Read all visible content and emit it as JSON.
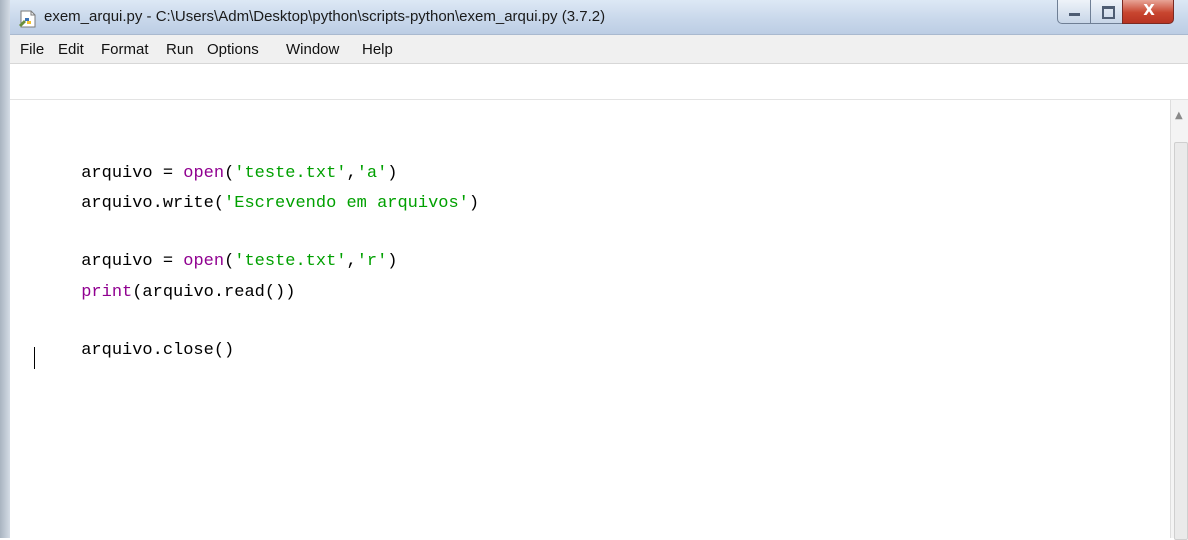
{
  "window": {
    "title": "exem_arqui.py - C:\\Users\\Adm\\Desktop\\python\\scripts-python\\exem_arqui.py (3.7.2)",
    "controls": {
      "minimize_icon": "minimize-icon",
      "maximize_icon": "maximize-icon",
      "close_label": "X"
    }
  },
  "menu": {
    "items": [
      {
        "label": "File"
      },
      {
        "label": "Edit"
      },
      {
        "label": "Format"
      },
      {
        "label": "Run"
      },
      {
        "label": "Options"
      },
      {
        "label": "Window"
      },
      {
        "label": "Help"
      }
    ]
  },
  "editor": {
    "lines": [
      {
        "parts": [
          {
            "text": "arquivo = ",
            "kind": "plain"
          },
          {
            "text": "open",
            "kind": "builtin"
          },
          {
            "text": "(",
            "kind": "plain"
          },
          {
            "text": "'teste.txt'",
            "kind": "string"
          },
          {
            "text": ",",
            "kind": "plain"
          },
          {
            "text": "'a'",
            "kind": "string"
          },
          {
            "text": ")",
            "kind": "plain"
          }
        ]
      },
      {
        "parts": [
          {
            "text": "arquivo.write(",
            "kind": "plain"
          },
          {
            "text": "'Escrevendo em arquivos'",
            "kind": "string"
          },
          {
            "text": ")",
            "kind": "plain"
          }
        ]
      },
      {
        "parts": [
          {
            "text": "arquivo = ",
            "kind": "plain"
          },
          {
            "text": "open",
            "kind": "builtin"
          },
          {
            "text": "(",
            "kind": "plain"
          },
          {
            "text": "'teste.txt'",
            "kind": "string"
          },
          {
            "text": ",",
            "kind": "plain"
          },
          {
            "text": "'r'",
            "kind": "string"
          },
          {
            "text": ")",
            "kind": "plain"
          }
        ]
      },
      {
        "parts": [
          {
            "text": "print",
            "kind": "builtin"
          },
          {
            "text": "(arquivo.read())",
            "kind": "plain"
          }
        ]
      },
      {
        "parts": [
          {
            "text": "arquivo.close()",
            "kind": "plain"
          }
        ]
      }
    ]
  },
  "colors": {
    "builtin": "#900090",
    "string": "#00a000",
    "plain": "#000000"
  }
}
